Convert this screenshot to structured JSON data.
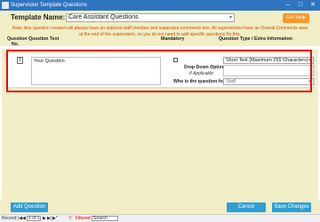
{
  "window": {
    "title": "Supervision Template Questions",
    "controls": {
      "minimize": "–",
      "maximize": "□",
      "close": "✕"
    }
  },
  "header": {
    "template_name_label": "Template Name:",
    "template_name_value": "Care Assistant Questions",
    "help_button": "Get Help",
    "note": "Note: Any question created will always have an optional staff member and supervisor comments box.  All supervisions have an Overall Comments area at the end of the supervision, so you do not need to add specific questions for this."
  },
  "columns": {
    "question_no": "Question No.",
    "question_text": "Question Text",
    "mandatory": "Mandatory",
    "question_type": "Question Type / Extra Information"
  },
  "row": {
    "number": "1",
    "question_text": "Your Question",
    "mandatory": false,
    "question_type": "Short Text (Maximum 255 Characters)",
    "drop_down_label": "Drop Down Options:",
    "drop_down_hint": "If Applicable",
    "who_label": "Who is the question for?",
    "who_value": "Staff"
  },
  "footer": {
    "add_button": "Add Question",
    "cancel_button": "Cancel Changes",
    "save_button": "Save Changes"
  },
  "record_nav": {
    "label": "Record:",
    "first": "|◀",
    "prev": "◀",
    "position": "1 of 1",
    "next": "▶",
    "last": "▶|",
    "new": "▶*",
    "filter_icon": "▽",
    "filtered": "Filtered",
    "search": "Search"
  },
  "colors": {
    "accent": "#2b9fd8",
    "header_background": "#f2eec6",
    "help_button": "#f39a2e",
    "highlight": "#e01010",
    "titlebar": "#2f74c0"
  }
}
